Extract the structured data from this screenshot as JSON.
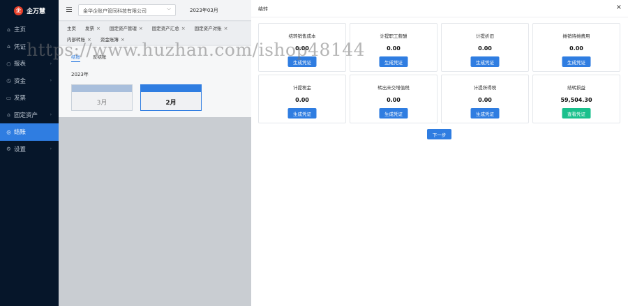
{
  "app": {
    "logo_mark": "企",
    "logo_text": "企万慧"
  },
  "sidebar": {
    "items": [
      {
        "icon": "home-icon",
        "glyph": "⌂",
        "label": "主页",
        "chevron": false
      },
      {
        "icon": "voucher-icon",
        "glyph": "⌂",
        "label": "凭证",
        "chevron": true
      },
      {
        "icon": "report-icon",
        "glyph": "○",
        "label": "报表",
        "chevron": true
      },
      {
        "icon": "fund-icon",
        "glyph": "◷",
        "label": "资金",
        "chevron": true
      },
      {
        "icon": "invoice-icon",
        "glyph": "▭",
        "label": "发票",
        "chevron": false
      },
      {
        "icon": "asset-icon",
        "glyph": "⌂",
        "label": "固定资产",
        "chevron": true
      },
      {
        "icon": "close-account-icon",
        "glyph": "◎",
        "label": "结账",
        "chevron": false,
        "active": true
      },
      {
        "icon": "settings-icon",
        "glyph": "⚙",
        "label": "设置",
        "chevron": true
      }
    ]
  },
  "topbar": {
    "company": "金华企账户管同科技有限公司",
    "period": "2023年03月"
  },
  "tabs": {
    "row1": [
      {
        "label": "主页",
        "closable": false
      },
      {
        "label": "发票",
        "closable": true
      },
      {
        "label": "固定资产管理",
        "closable": true
      },
      {
        "label": "固定资产汇总",
        "closable": true
      },
      {
        "label": "固定资产对账",
        "closable": true
      }
    ],
    "row2": [
      {
        "label": "内部转账",
        "closable": true
      },
      {
        "label": "资金账簿",
        "closable": true
      }
    ]
  },
  "panel": {
    "subtabs": [
      "结账",
      "反结账"
    ],
    "year": "2023年",
    "months": [
      {
        "label": "3月",
        "current": false
      },
      {
        "label": "2月",
        "current": true
      }
    ]
  },
  "dialog": {
    "title": "结转",
    "close_glyph": "×",
    "cards": [
      {
        "title": "结转销售成本",
        "value": "0.00",
        "button": "生成凭证",
        "style": "blue"
      },
      {
        "title": "计提职工薪酬",
        "value": "0.00",
        "button": "生成凭证",
        "style": "blue"
      },
      {
        "title": "计提折旧",
        "value": "0.00",
        "button": "生成凭证",
        "style": "blue"
      },
      {
        "title": "摊销待摊费用",
        "value": "0.00",
        "button": "生成凭证",
        "style": "blue"
      },
      {
        "title": "计提税金",
        "value": "0.00",
        "button": "生成凭证",
        "style": "blue"
      },
      {
        "title": "转出未交增值税",
        "value": "0.00",
        "button": "生成凭证",
        "style": "blue"
      },
      {
        "title": "计提所得税",
        "value": "0.00",
        "button": "生成凭证",
        "style": "blue"
      },
      {
        "title": "结转损益",
        "value": "59,504.30",
        "button": "查看凭证",
        "style": "green"
      }
    ],
    "next_label": "下一步"
  },
  "watermark": "https://www.huzhan.com/ishop48144",
  "colors": {
    "sidebar_bg": "#06162a",
    "accent": "#2f7de1",
    "green": "#19c08c"
  }
}
